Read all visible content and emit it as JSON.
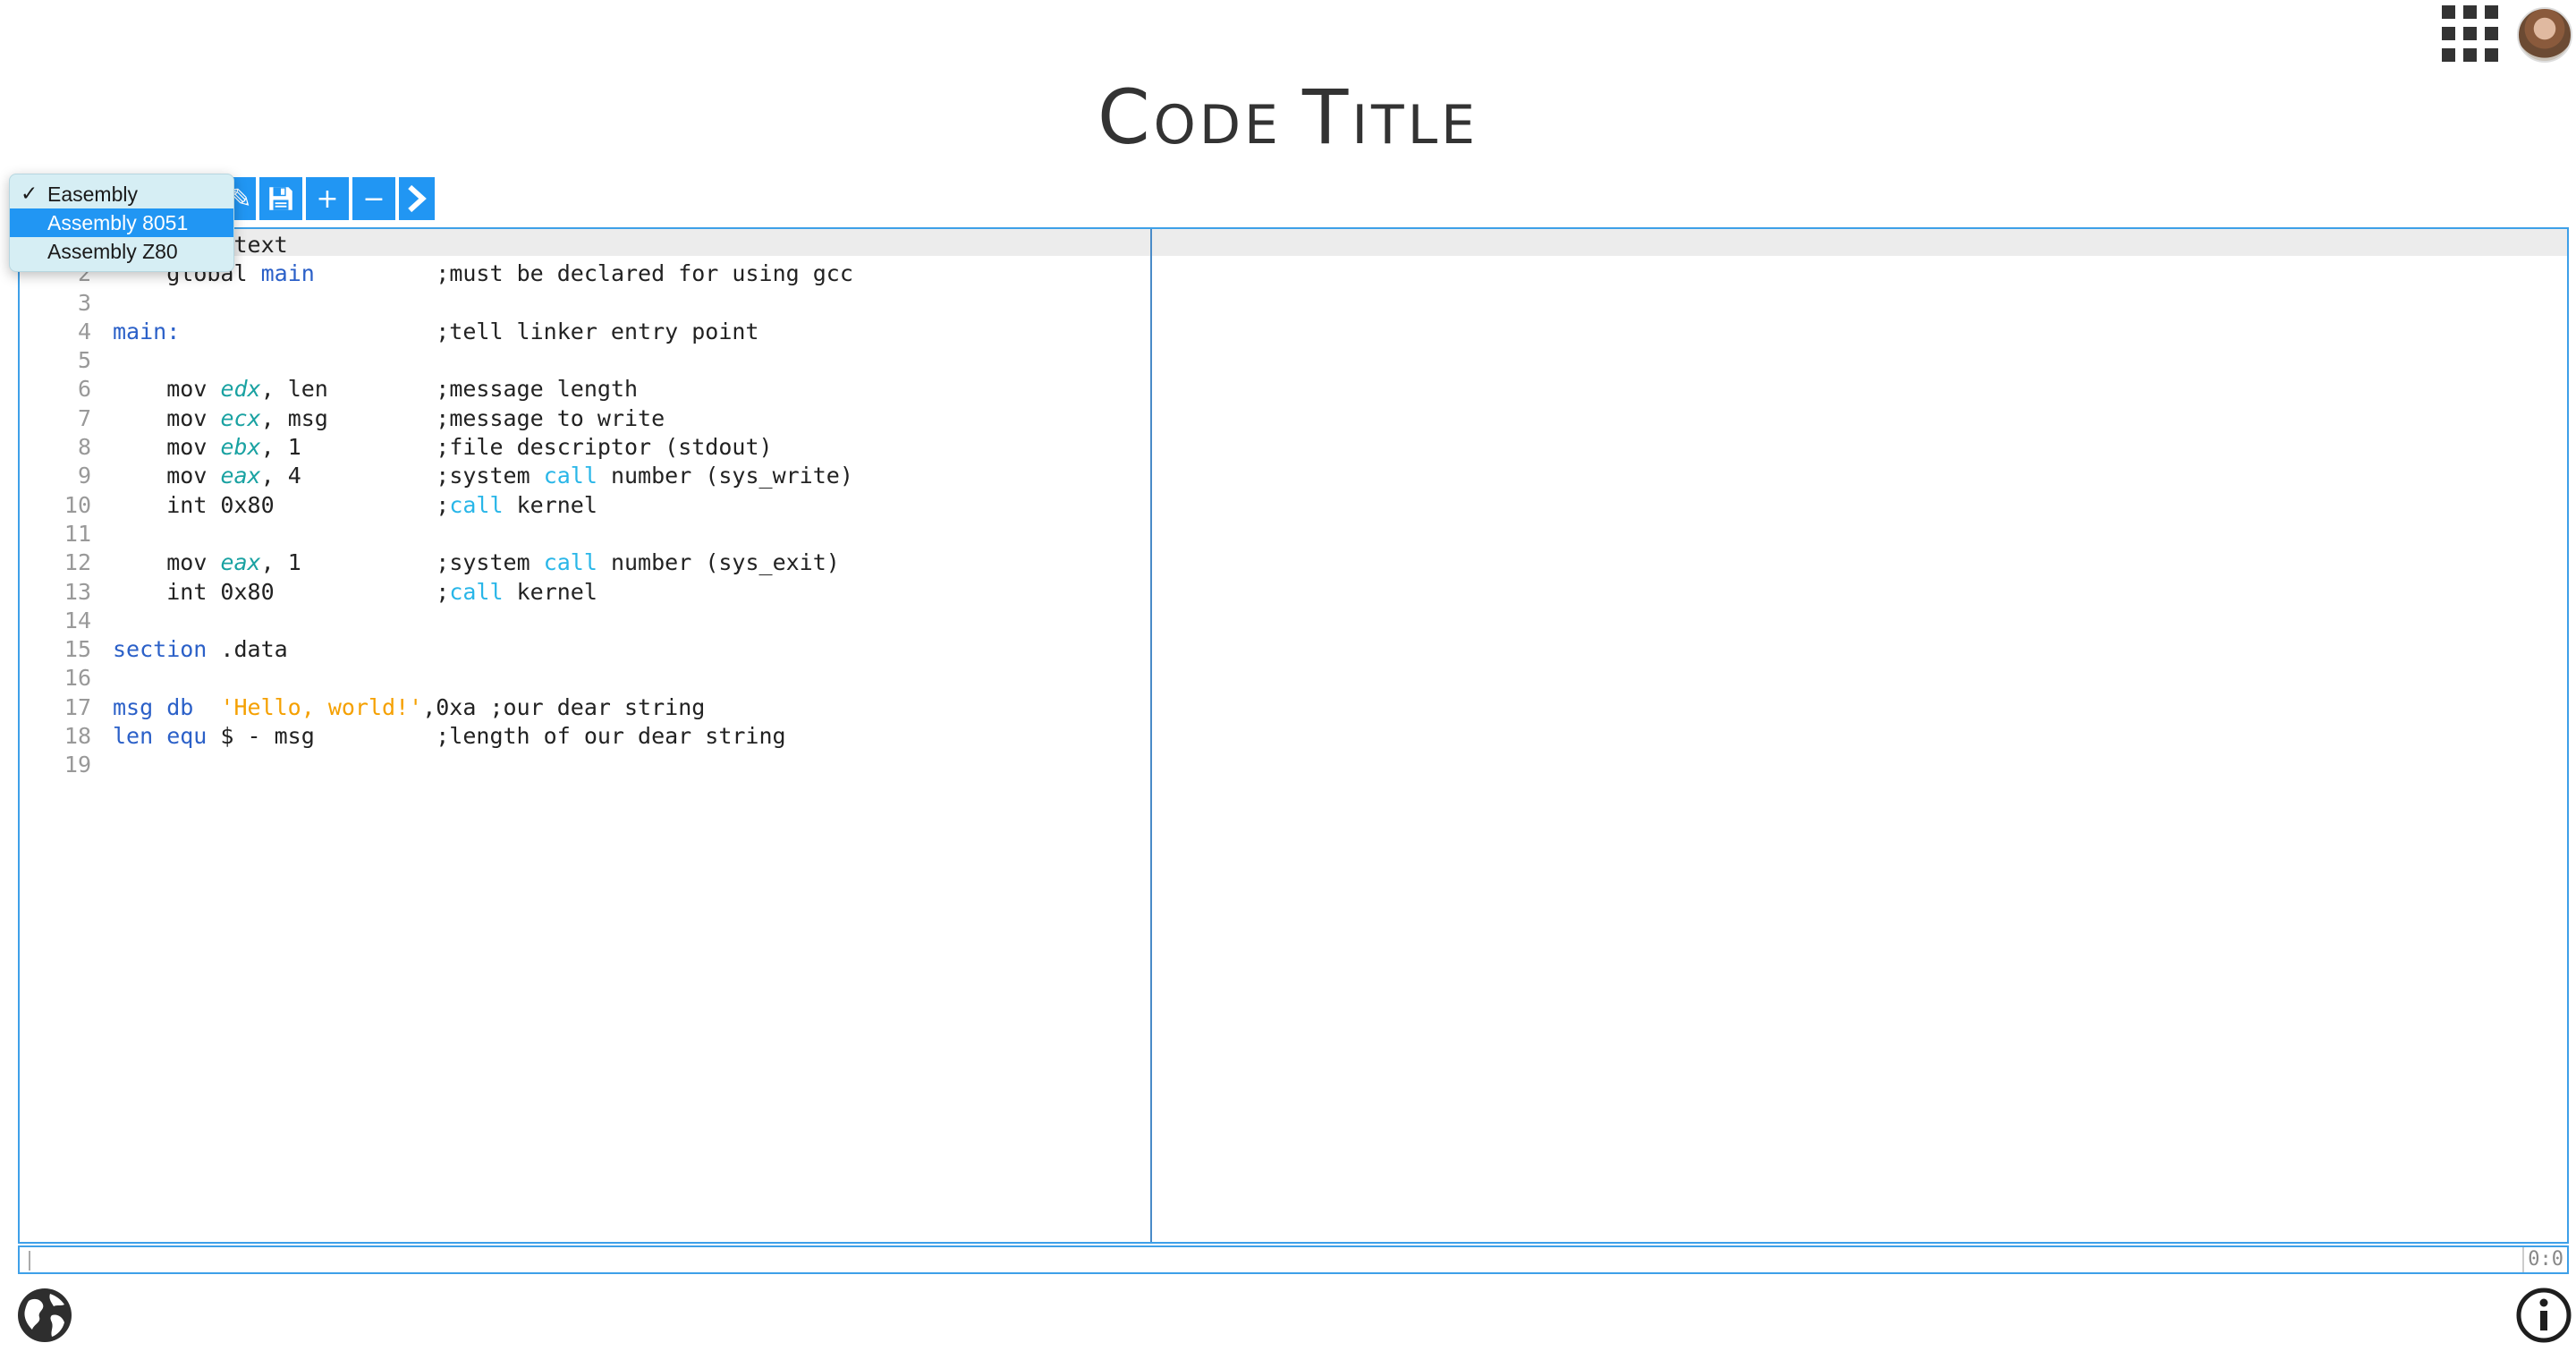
{
  "header": {
    "title_big_1": "C",
    "title_small_1": "ode ",
    "title_big_2": "T",
    "title_small_2": "itle"
  },
  "icons": {
    "apps": "apps-grid-icon",
    "avatar": "user-avatar",
    "edit": "pencil-icon",
    "save": "floppy-disk-icon",
    "plus": "plus-icon",
    "minus": "minus-icon",
    "run": "chevron-right-icon",
    "globe": "globe-icon",
    "info": "info-icon"
  },
  "toolbar": {
    "edit_label": "✎",
    "plus_label": "+",
    "minus_label": "−"
  },
  "language_menu": {
    "items": [
      {
        "label": "Easembly",
        "checked": true
      },
      {
        "label": "Assembly 8051",
        "highlighted": true
      },
      {
        "label": "Assembly Z80"
      }
    ],
    "check_mark": "✓"
  },
  "editor": {
    "line_numbers": [
      "",
      "2",
      "3",
      "4",
      "5",
      "6",
      "7",
      "8",
      "9",
      "10",
      "11",
      "12",
      "13",
      "14",
      "15",
      "16",
      "17",
      "18",
      "19"
    ],
    "first_line_text": "        .text"
  },
  "status": {
    "cursor_position": "0:0"
  },
  "colors": {
    "accent": "#2196f3",
    "border": "#3ea0e8",
    "keyword": "#2b60c8",
    "register": "#1aa2a2",
    "string": "#f5a000",
    "call": "#29b6e8"
  }
}
